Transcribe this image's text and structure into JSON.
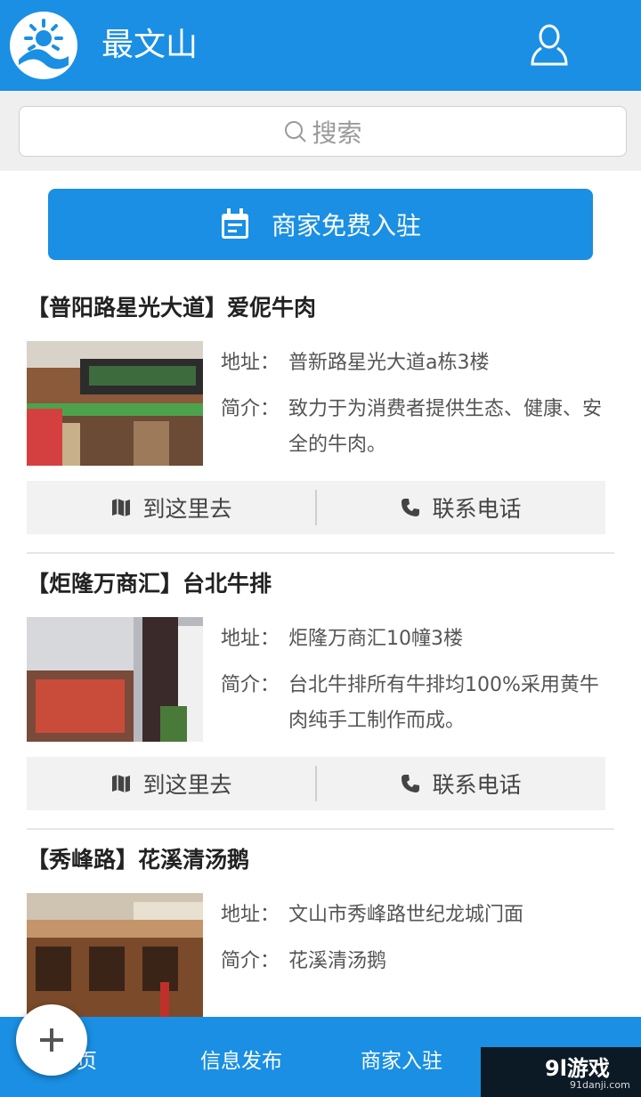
{
  "header": {
    "app_title": "最文山",
    "logo_icon": "sunflower-logo-icon",
    "user_icon": "user-icon"
  },
  "search": {
    "placeholder": "搜索"
  },
  "cta": {
    "label": "商家免费入驻"
  },
  "listings": [
    {
      "title": "【普阳路星光大道】爱伲牛肉",
      "address_label": "地址：",
      "address": "普新路星光大道a栋3楼",
      "intro_label": "简介：",
      "intro": "致力于为消费者提供生态、健康、安全的牛肉。",
      "go_label": "到这里去",
      "call_label": "联系电话"
    },
    {
      "title": "【炬隆万商汇】台北牛排",
      "address_label": "地址：",
      "address": "炬隆万商汇10幢3楼",
      "intro_label": "简介：",
      "intro": "台北牛排所有牛排均100%采用黄牛肉纯手工制作而成。",
      "go_label": "到这里去",
      "call_label": "联系电话"
    },
    {
      "title": "【秀峰路】花溪清汤鹅",
      "address_label": "地址：",
      "address": "文山市秀峰路世纪龙城门面",
      "intro_label": "简介：",
      "intro": "花溪清汤鹅"
    }
  ],
  "bottom_nav": {
    "items": [
      "页",
      "信息发布",
      "商家入驻"
    ]
  },
  "watermark": {
    "main": "9l游戏",
    "sub": "91danji.com"
  },
  "colors": {
    "accent": "#1a8fe3"
  }
}
